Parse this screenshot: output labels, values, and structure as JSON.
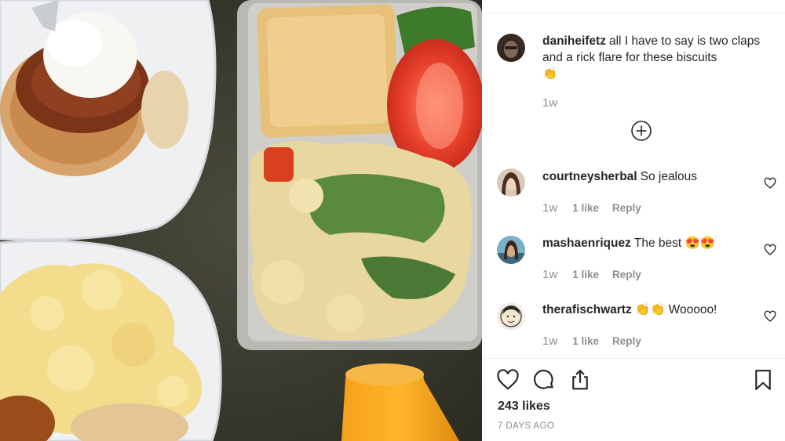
{
  "post": {
    "caption": {
      "username": "daniheifetz",
      "text": "all I have to say is two claps and a rick flare for these biscuits",
      "emoji": "👏",
      "time": "1w"
    },
    "load_more_icon": "plus-circle-icon",
    "comments": [
      {
        "username": "courtneysherbal",
        "text": "So jealous",
        "time": "1w",
        "likes": "1 like",
        "reply": "Reply"
      },
      {
        "username": "mashaenriquez",
        "text": "The best 😍😍",
        "time": "1w",
        "likes": "1 like",
        "reply": "Reply"
      },
      {
        "username": "therafischwartz",
        "text": "👏👏 Wooooo!",
        "time": "1w",
        "likes": "1 like",
        "reply": "Reply"
      }
    ],
    "actions": {
      "like_icon": "heart-icon",
      "comment_icon": "comment-bubble-icon",
      "share_icon": "share-icon",
      "save_icon": "bookmark-icon"
    },
    "likes_count": "243 likes",
    "date": "7 DAYS AGO"
  },
  "colors": {
    "text": "#262626",
    "muted": "#8e8e8e",
    "divider": "#efefef"
  }
}
